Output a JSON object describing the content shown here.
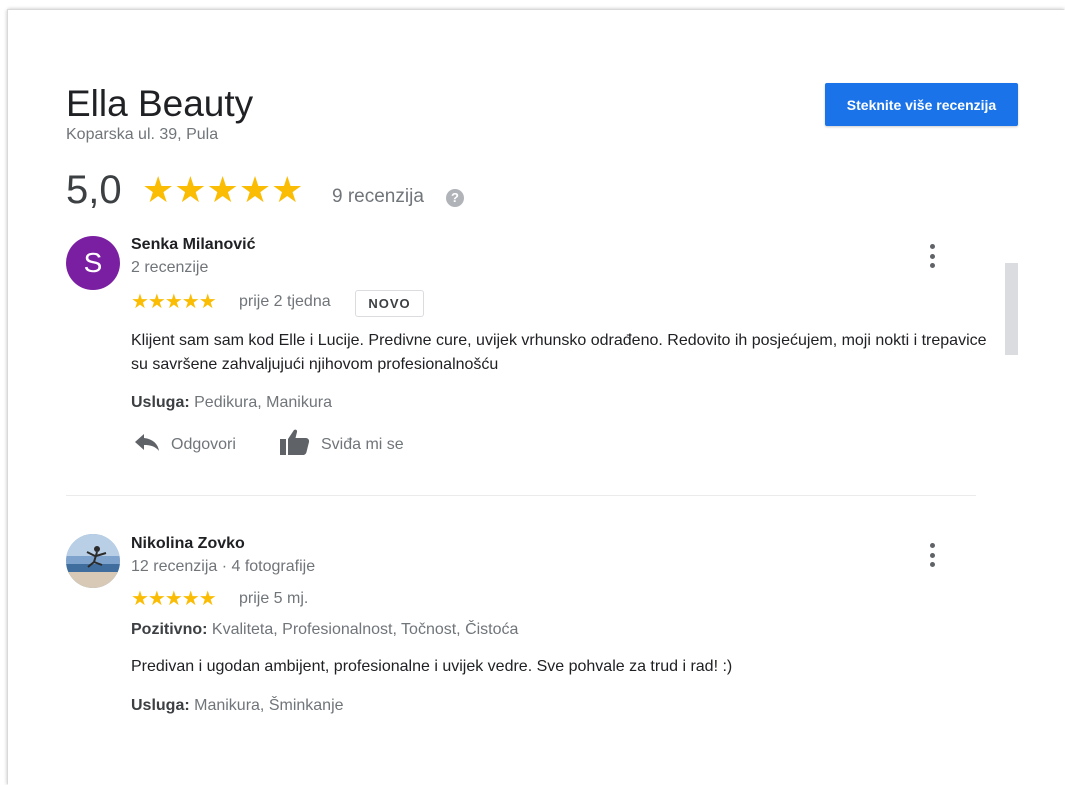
{
  "business": {
    "name": "Ella Beauty",
    "address": "Koparska ul. 39, Pula",
    "get_more_reviews_label": "Steknite više recenzija",
    "rating": "5,0",
    "stars": "★★★★★",
    "review_count": "9 recenzija",
    "help_glyph": "?"
  },
  "reviews": [
    {
      "avatar_initial": "S",
      "avatar_color": "#7b1fa2",
      "name": "Senka Milanović",
      "meta": "2 recenzije",
      "stars": "★★★★★",
      "rating_value": 5,
      "time": "prije 2 tjedna",
      "badge": "NOVO",
      "text": "Klijent sam sam kod Elle i Lucije. Predivne cure, uvijek vrhunsko odrađeno. Redovito ih posjećujem, moji nokti i trepavice su savršene zahvaljujući njihovom profesionalnošću",
      "service_label": "Usluga:",
      "service_value": "Pedikura, Manikura",
      "reply_label": "Odgovori",
      "like_label": "Sviđa mi se"
    },
    {
      "name": "Nikolina Zovko",
      "meta": "12 recenzija · 4 fotografije",
      "stars": "★★★★★",
      "rating_value": 5,
      "time": "prije 5 mj.",
      "positive_label": "Pozitivno:",
      "positive_value": "Kvaliteta, Profesionalnost, Točnost, Čistoća",
      "text": "Predivan i ugodan ambijent, profesionalne i uvijek vedre. Sve pohvale za trud i rad! :)",
      "service_label": "Usluga:",
      "service_value": "Manikura, Šminkanje"
    }
  ],
  "colors": {
    "accent_blue": "#1a73e8",
    "star_yellow": "#fbbc04"
  },
  "icons": [
    "help-icon",
    "reply-icon",
    "thumbs-up-icon",
    "more-vert-icon"
  ]
}
